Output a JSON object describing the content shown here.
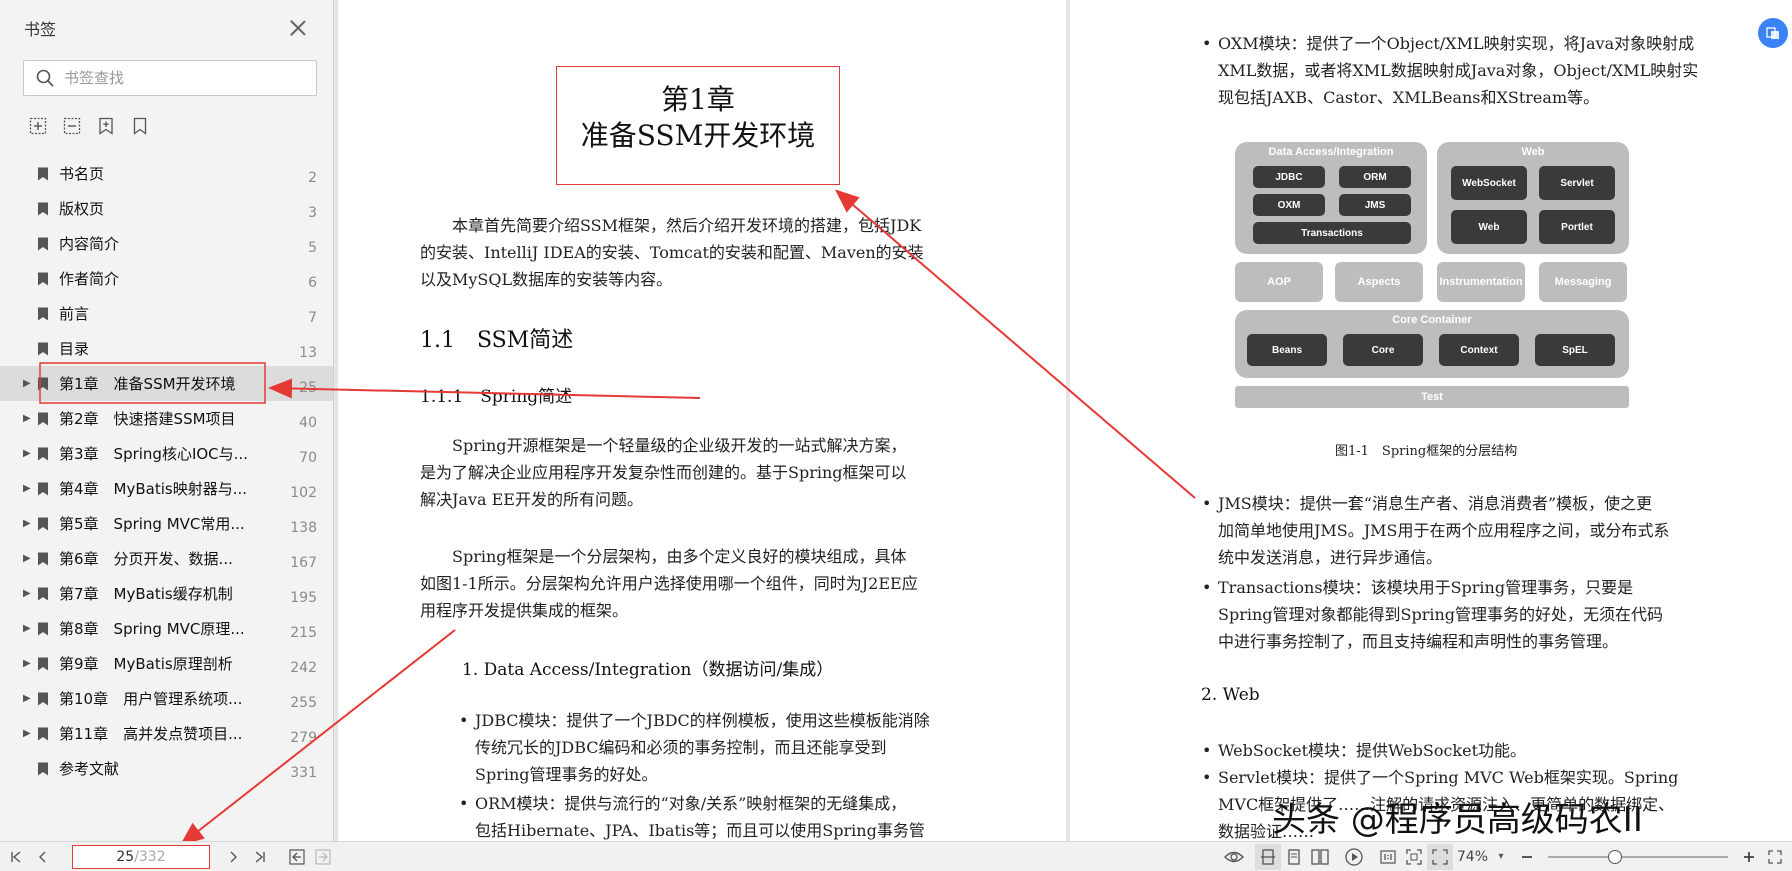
{
  "sidebar": {
    "title": "书签",
    "search_placeholder": "书签查找",
    "items": [
      {
        "label": "书名页",
        "page": "2",
        "expandable": false
      },
      {
        "label": "版权页",
        "page": "3",
        "expandable": false
      },
      {
        "label": "内容简介",
        "page": "5",
        "expandable": false
      },
      {
        "label": "作者简介",
        "page": "6",
        "expandable": false
      },
      {
        "label": "前言",
        "page": "7",
        "expandable": false
      },
      {
        "label": "目录",
        "page": "13",
        "expandable": false
      },
      {
        "label": "第1章　准备SSM开发环境",
        "page": "25",
        "expandable": true,
        "active": true
      },
      {
        "label": "第2章　快速搭建SSM项目",
        "page": "40",
        "expandable": true
      },
      {
        "label": "第3章　Spring核心IOC与...",
        "page": "70",
        "expandable": true
      },
      {
        "label": "第4章　MyBatis映射器与...",
        "page": "102",
        "expandable": true
      },
      {
        "label": "第5章　Spring MVC常用...",
        "page": "138",
        "expandable": true
      },
      {
        "label": "第6章　分页开发、数据...",
        "page": "167",
        "expandable": true
      },
      {
        "label": "第7章　MyBatis缓存机制",
        "page": "195",
        "expandable": true
      },
      {
        "label": "第8章　Spring MVC原理...",
        "page": "215",
        "expandable": true
      },
      {
        "label": "第9章　MyBatis原理剖析",
        "page": "242",
        "expandable": true
      },
      {
        "label": "第10章　用户管理系统项...",
        "page": "255",
        "expandable": true
      },
      {
        "label": "第11章　高并发点赞项目...",
        "page": "279",
        "expandable": true
      },
      {
        "label": "参考文献",
        "page": "331",
        "expandable": false
      }
    ]
  },
  "left_page": {
    "chapter_line1": "第1章",
    "chapter_line2": "准备SSM开发环境",
    "intro": [
      "　　本章首先简要介绍SSM框架，然后介绍开发环境的搭建，包括JDK",
      "的安装、IntelliJ IDEA的安装、Tomcat的安装和配置、Maven的安装",
      "以及MySQL数据库的安装等内容。"
    ],
    "h1": "1.1　SSM简述",
    "h2": "1.1.1　Spring简述",
    "p1": [
      "　　Spring开源框架是一个轻量级的企业级开发的一站式解决方案，",
      "是为了解决企业应用程序开发复杂性而创建的。基于Spring框架可以",
      "解决Java EE开发的所有问题。"
    ],
    "p2": [
      "　　Spring框架是一个分层架构，由多个定义良好的模块组成，具体",
      "如图1-1所示。分层架构允许用户选择使用哪一个组件，同时为J2EE应",
      "用程序开发提供集成的框架。"
    ],
    "sub1": "1. Data Access/Integration（数据访问/集成）",
    "jdbc": [
      "JDBC模块：提供了一个JBDC的样例模板，使用这些模板能消除",
      "传统冗长的JDBC编码和必须的事务控制，而且还能享受到",
      "Spring管理事务的好处。"
    ],
    "orm": [
      "ORM模块：提供与流行的“对象/关系”映射框架的无缝集成，",
      "包括Hibernate、JPA、Ibatis等；而且可以使用Spring事务管"
    ]
  },
  "right_page": {
    "oxm": [
      "OXM模块：提供了一个Object/XML映射实现，将Java对象映射成",
      "XML数据，或者将XML数据映射成Java对象，Object/XML映射实",
      "现包括JAXB、Castor、XMLBeans和XStream等。"
    ],
    "diagram": {
      "data_access_title": "Data Access/Integration",
      "data_access_boxes": [
        "JDBC",
        "ORM",
        "OXM",
        "JMS",
        "Transactions"
      ],
      "web_title": "Web",
      "web_boxes": [
        "WebSocket",
        "Servlet",
        "Web",
        "Portlet"
      ],
      "middle": [
        "AOP",
        "Aspects",
        "Instrumentation",
        "Messaging"
      ],
      "core_title": "Core Container",
      "core_boxes": [
        "Beans",
        "Core",
        "Context",
        "SpEL"
      ],
      "test": "Test"
    },
    "caption": "图1-1　Spring框架的分层结构",
    "jms": [
      "JMS模块：提供一套“消息生产者、消息消费者”模板，使之更",
      "加简单地使用JMS。JMS用于在两个应用程序之间，或分布式系",
      "统中发送消息，进行异步通信。"
    ],
    "transactions": [
      "Transactions模块：该模块用于Spring管理事务，只要是",
      "Spring管理对象都能得到Spring管理事务的好处，无须在代码",
      "中进行事务控制了，而且支持编程和声明性的事务管理。"
    ],
    "sub2": "2. Web",
    "websocket": [
      "WebSocket模块：提供WebSocket功能。"
    ],
    "servlet": [
      "Servlet模块：提供了一个Spring MVC Web框架实现。Spring",
      "MVC框架提供了……注解的请求资源注入、更简单的数据绑定、",
      "数据验证……"
    ]
  },
  "watermark": "头条 @程序员高级码农II",
  "bottombar": {
    "current_page": "25",
    "total_pages": "/332",
    "zoom": "74%"
  },
  "colors": {
    "annotation": "#e53935",
    "sidebar_bg": "#f3f3f3",
    "active_item": "#dcdcdc"
  }
}
